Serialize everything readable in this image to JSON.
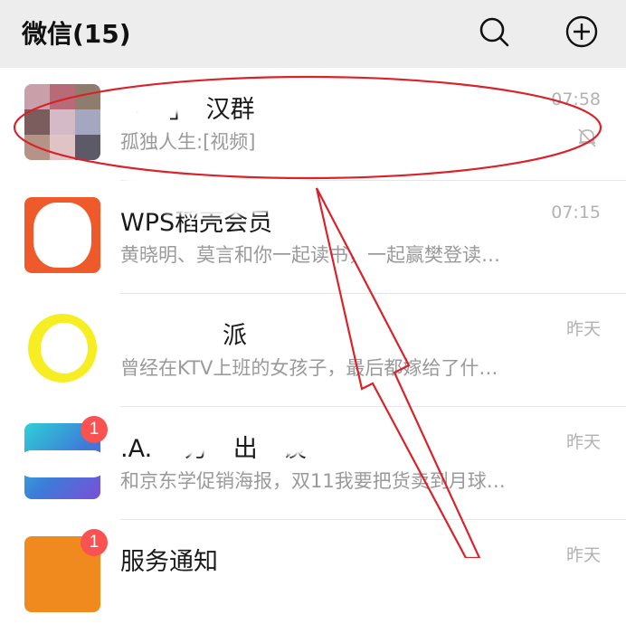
{
  "header": {
    "title": "微信(15)",
    "search_icon": "search-icon",
    "add_icon": "plus-circle-icon"
  },
  "chats": [
    {
      "name": "「　」　汉群",
      "name_visible": "汉群",
      "preview": "孤独人生:[视频]",
      "time": "07:58",
      "muted": true,
      "avatar": "group-photo-grid"
    },
    {
      "name": "WPS稻壳会员",
      "preview": "黄晓明、莫言和你一起读书，一起赢樊登读…",
      "time": "07:15",
      "avatar": "orange-app-logo"
    },
    {
      "name": "派",
      "preview": "曾经在KTV上班的女孩子，最后都嫁给了什…",
      "time": "昨天",
      "avatar": "yellow-circle-logo"
    },
    {
      "name": ".A.  　方　出　谈",
      "preview": "和京东学促销海报，双11我要把货卖到月球…",
      "time": "昨天",
      "badge": "1",
      "avatar": "blue-gradient-logo"
    },
    {
      "name": "服务通知",
      "preview": "",
      "time": "昨天",
      "badge": "1",
      "avatar": "orange-service-icon"
    }
  ],
  "annotation": {
    "ellipse_color": "#d9232a",
    "arrow_color": "#d9232a"
  }
}
